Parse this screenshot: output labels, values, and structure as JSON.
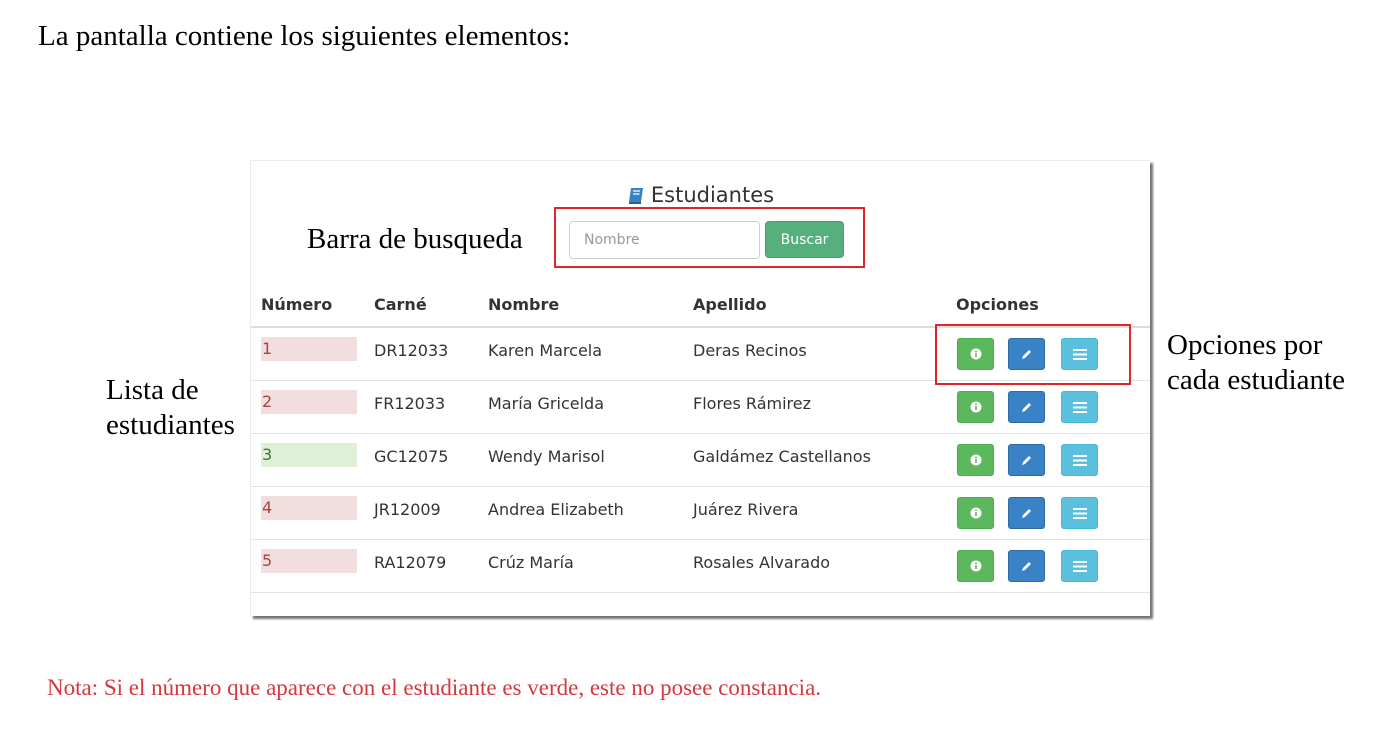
{
  "doc": {
    "intro": "La pantalla contiene los siguientes elementos:",
    "label_search": "Barra de busqueda",
    "label_list_line1": "Lista de",
    "label_list_line2": "estudiantes",
    "label_options_line1": "Opciones por",
    "label_options_line2": "cada estudiante",
    "note": "Nota: Si el número que aparece con el estudiante es verde, este no posee constancia."
  },
  "panel": {
    "title": "Estudiantes",
    "title_icon": "book-icon",
    "search": {
      "placeholder": "Nombre",
      "value": "",
      "button_label": "Buscar"
    },
    "columns": {
      "numero": "Número",
      "carne": "Carné",
      "nombre": "Nombre",
      "apellido": "Apellido",
      "opciones": "Opciones"
    },
    "students": [
      {
        "numero": "1",
        "status": "red",
        "carne": "DR12033",
        "nombre": "Karen Marcela",
        "apellido": "Deras Recinos"
      },
      {
        "numero": "2",
        "status": "red",
        "carne": "FR12033",
        "nombre": "María Gricelda",
        "apellido": "Flores Rámirez"
      },
      {
        "numero": "3",
        "status": "green",
        "carne": "GC12075",
        "nombre": "Wendy Marisol",
        "apellido": "Galdámez Castellanos"
      },
      {
        "numero": "4",
        "status": "red",
        "carne": "JR12009",
        "nombre": "Andrea Elizabeth",
        "apellido": "Juárez Rivera"
      },
      {
        "numero": "5",
        "status": "red",
        "carne": "RA12079",
        "nombre": "Crúz María",
        "apellido": "Rosales Alvarado"
      }
    ],
    "option_icons": [
      "info-icon",
      "pencil-icon",
      "list-icon"
    ]
  },
  "colors": {
    "status_red_bg": "#f2dede",
    "status_red_text": "#a94442",
    "status_green_bg": "#dff0d8",
    "status_green_text": "#3c763d",
    "search_button": "#55b07c",
    "btn_info": "#5cb85c",
    "btn_edit": "#3a82c6",
    "btn_list": "#5bc0de",
    "highlight": "#e0262b",
    "note_text": "#d6373c"
  }
}
